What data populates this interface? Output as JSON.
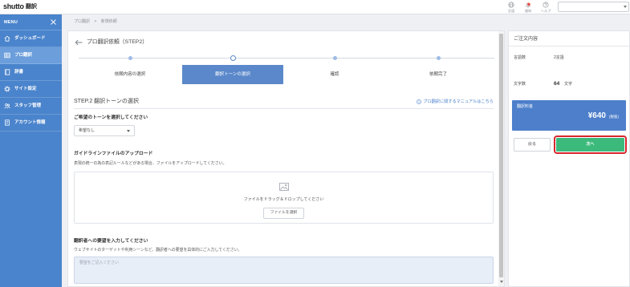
{
  "header": {
    "logo_main": "shutto",
    "logo_sub": "翻訳",
    "nav_icons": [
      {
        "icon": "globe-icon",
        "label": "言語"
      },
      {
        "icon": "bell-icon",
        "label": "通知",
        "has_badge": true
      },
      {
        "icon": "help-icon",
        "label": "ヘルプ"
      }
    ]
  },
  "sidebar": {
    "menu_label": "MENU",
    "items": [
      {
        "icon": "home-icon",
        "label": "ダッシュボード",
        "active": false
      },
      {
        "icon": "table-icon",
        "label": "プロ翻訳",
        "active": true
      },
      {
        "icon": "book-icon",
        "label": "辞書",
        "active": false
      },
      {
        "icon": "gear-icon",
        "label": "サイト設定",
        "active": false
      },
      {
        "icon": "staff-icon",
        "label": "スタッフ管理",
        "active": false
      },
      {
        "icon": "document-icon",
        "label": "アカウント情報",
        "active": false
      }
    ]
  },
  "breadcrumb": {
    "items": [
      "プロ翻訳",
      "新規依頼"
    ],
    "separator": ">"
  },
  "main": {
    "title": "プロ翻訳依頼（STEP2）",
    "steps": [
      {
        "label": "依頼内容の選択"
      },
      {
        "label": "翻訳トーンの選択"
      },
      {
        "label": "確認"
      },
      {
        "label": "依頼完了"
      }
    ],
    "active_step": 1,
    "section_heading": "STEP.2 翻訳トーンの選択",
    "manual_link": "プロ翻訳に関するマニュアルはこちら",
    "tone": {
      "heading": "ご希望のトーンを選択してください",
      "selected": "希望なし"
    },
    "upload": {
      "heading": "ガイドラインファイルのアップロード",
      "description": "表現の統一の為の表記ルールなどがある場合、ファイルをアップロードしてください。",
      "dropzone_text": "ファイルをドラッグ＆ドロップしてください",
      "choose_button": "ファイルを選択"
    },
    "request": {
      "heading": "翻訳者への要望を入力してください",
      "description": "ウェブサイトのターゲットや利用シーンなど、翻訳者への要望を具体的にご入力してください。",
      "placeholder": "要望をご記入ください",
      "value": ""
    }
  },
  "order": {
    "title": "ご注文内容",
    "languages_label": "言語数",
    "languages_value": "2言語",
    "chars_label": "文字数",
    "chars_value": "64",
    "chars_unit": "文字",
    "price_label": "翻訳料金",
    "price_amount": "¥640",
    "price_note": "(税抜)",
    "back_button": "戻る",
    "next_button": "次へ"
  },
  "colors": {
    "sidebar": "#4a84cc",
    "sidebar_active": "#6b9edb",
    "accent": "#5a88ca",
    "link": "#4a7fcc",
    "price_box": "#4d7fcb",
    "next_button": "#3cba7c",
    "highlight": "#d7262d"
  }
}
